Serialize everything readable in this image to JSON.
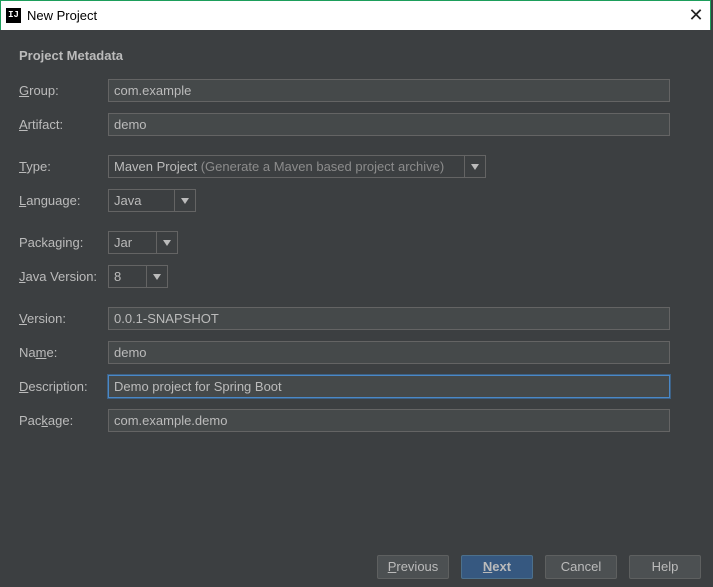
{
  "window": {
    "app_icon_text": "IJ",
    "title": "New Project",
    "close_glyph": "✕"
  },
  "section_title": "Project Metadata",
  "fields": {
    "group": {
      "mnemonic": "G",
      "rest": "roup:",
      "value": "com.example"
    },
    "artifact": {
      "mnemonic": "A",
      "rest": "rtifact:",
      "value": "demo"
    },
    "type": {
      "mnemonic": "T",
      "rest": "ype:",
      "value": "Maven Project",
      "hint": "(Generate a Maven based project archive)"
    },
    "language": {
      "mnemonic": "L",
      "rest": "anguage:",
      "value": "Java"
    },
    "packaging": {
      "label": "Packaging:",
      "value": "Jar"
    },
    "java_version": {
      "mnemonic": "J",
      "rest": "ava Version:",
      "value": "8"
    },
    "version": {
      "mnemonic": "V",
      "rest": "ersion:",
      "value": "0.0.1-SNAPSHOT"
    },
    "name": {
      "pre": "Na",
      "mnemonic": "m",
      "rest": "e:",
      "value": "demo"
    },
    "description": {
      "mnemonic": "D",
      "rest": "escription:",
      "value": "Demo project for Spring Boot"
    },
    "package": {
      "pre": "Pac",
      "mnemonic": "k",
      "rest": "age:",
      "value": "com.example.demo"
    }
  },
  "buttons": {
    "previous": {
      "mnemonic": "P",
      "rest": "revious"
    },
    "next": {
      "mnemonic": "N",
      "rest": "ext"
    },
    "cancel": "Cancel",
    "help": "Help"
  }
}
